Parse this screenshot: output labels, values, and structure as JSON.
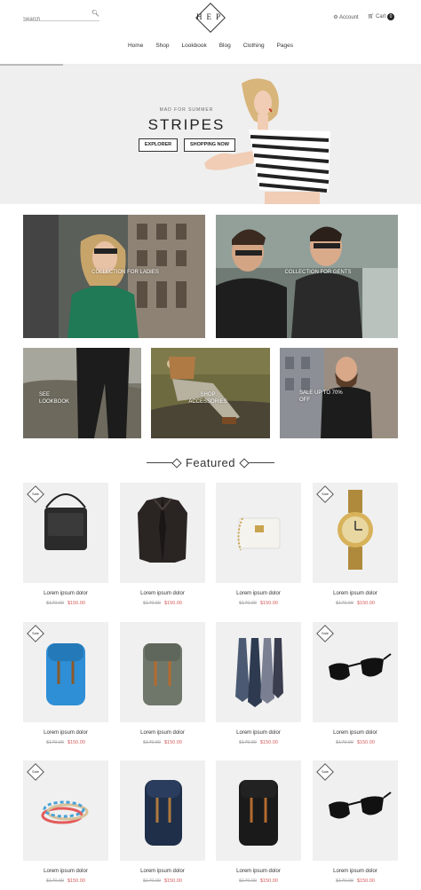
{
  "header": {
    "search_placeholder": "Search",
    "logo_text": "HEP",
    "account_label": "Account",
    "cart_label": "Cart",
    "cart_count": "0"
  },
  "nav": [
    "Home",
    "Shop",
    "Lookbook",
    "Blog",
    "Clothing",
    "Pages"
  ],
  "slider_progress_percent": 15,
  "hero": {
    "kicker": "MAD FOR SUMMER",
    "title": "STRIPES",
    "button_explorer": "EXPLORER",
    "button_shop": "SHOPPING NOW"
  },
  "collections": {
    "ladies": "COLLECTION FOR LADIES",
    "gents": "COLLECTION FOR GENTS",
    "lookbook": "SEE\nLOOKBOOK",
    "accessories": "SHOP\nACCESSORIES",
    "sale": "SALE UP TO 70%\nOFF"
  },
  "featured_title": "Featured",
  "products": [
    {
      "name": "Lorem ipsum dolor",
      "old": "$170.00",
      "new": "$150.00",
      "sale": true,
      "icon": "messenger-bag-icon"
    },
    {
      "name": "Lorem ipsum dolor",
      "old": "$170.00",
      "new": "$150.00",
      "sale": false,
      "icon": "leather-jacket-icon"
    },
    {
      "name": "Lorem ipsum dolor",
      "old": "$170.00",
      "new": "$150.00",
      "sale": false,
      "icon": "white-purse-icon"
    },
    {
      "name": "Lorem ipsum dolor",
      "old": "$170.00",
      "new": "$150.00",
      "sale": true,
      "icon": "gold-watch-icon"
    },
    {
      "name": "Lorem ipsum dolor",
      "old": "$170.00",
      "new": "$150.00",
      "sale": true,
      "icon": "blue-backpack-icon"
    },
    {
      "name": "Lorem ipsum dolor",
      "old": "$170.00",
      "new": "$150.00",
      "sale": false,
      "icon": "grey-backpack-icon"
    },
    {
      "name": "Lorem ipsum dolor",
      "old": "$170.00",
      "new": "$150.00",
      "sale": false,
      "icon": "neckties-icon"
    },
    {
      "name": "Lorem ipsum dolor",
      "old": "$170.00",
      "new": "$150.00",
      "sale": true,
      "icon": "sunglasses-icon"
    },
    {
      "name": "Lorem ipsum dolor",
      "old": "$170.00",
      "new": "$150.00",
      "sale": true,
      "icon": "bracelets-icon"
    },
    {
      "name": "Lorem ipsum dolor",
      "old": "$170.00",
      "new": "$150.00",
      "sale": false,
      "icon": "navy-backpack-icon"
    },
    {
      "name": "Lorem ipsum dolor",
      "old": "$170.00",
      "new": "$150.00",
      "sale": false,
      "icon": "black-backpack-icon"
    },
    {
      "name": "Lorem ipsum dolor",
      "old": "$170.00",
      "new": "$150.00",
      "sale": true,
      "icon": "sunglasses-icon"
    }
  ],
  "sale_badge": "Sale"
}
